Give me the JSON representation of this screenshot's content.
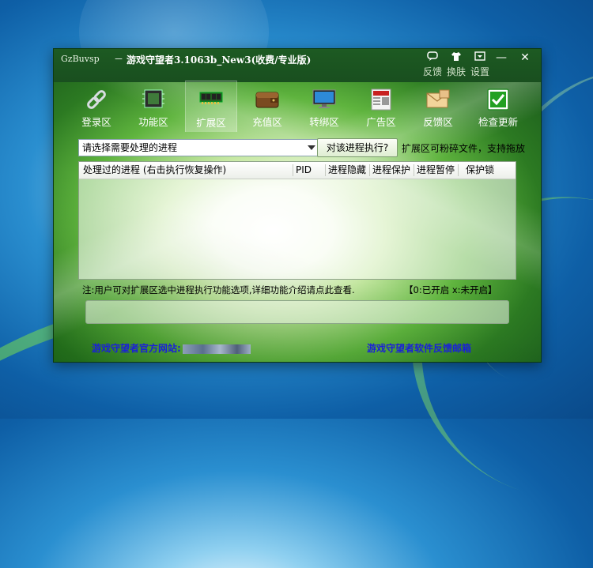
{
  "window": {
    "app_name": "GzBuvsp",
    "title_dash": "－",
    "title": "游戏守望者3.1063b_New3(收费/专业版)"
  },
  "title_buttons": [
    {
      "label": "反馈",
      "icon": "feedback-bubble-icon"
    },
    {
      "label": "换肤",
      "icon": "shirt-icon"
    },
    {
      "label": "设置",
      "icon": "settings-box-icon"
    }
  ],
  "window_controls": {
    "minimize": "—",
    "close": "✕"
  },
  "nav": [
    {
      "label": "登录区",
      "icon": "chain-link-icon"
    },
    {
      "label": "功能区",
      "icon": "chip-icon"
    },
    {
      "label": "扩展区",
      "icon": "memory-module-icon",
      "active": true
    },
    {
      "label": "充值区",
      "icon": "wallet-icon"
    },
    {
      "label": "转绑区",
      "icon": "monitor-icon"
    },
    {
      "label": "广告区",
      "icon": "newspaper-icon"
    },
    {
      "label": "反馈区",
      "icon": "envelope-icon"
    },
    {
      "label": "检查更新",
      "icon": "green-check-icon"
    }
  ],
  "process_select": {
    "value": "请选择需要处理的进程"
  },
  "exec_button": "对该进程执行?",
  "side_note": "扩展区可粉碎文件，支持拖放",
  "table": {
    "columns": [
      "处理过的进程 (右击执行恢复操作)",
      "PID",
      "进程隐藏",
      "进程保护",
      "进程暂停",
      "保护锁"
    ],
    "rows": []
  },
  "footer_note": "注:用户可对扩展区选中进程执行功能选项,详细功能介绍请点此查看.",
  "legend": "【0:已开启  x:未开启】",
  "message_box": "",
  "links": {
    "official_site": "游戏守望者官方网站:",
    "feedback_mail": "游戏守望者软件反馈邮箱"
  },
  "colors": {
    "title_bar": "#1d5a22",
    "link": "#1a20d8",
    "accent_green": "#5fb43e"
  }
}
